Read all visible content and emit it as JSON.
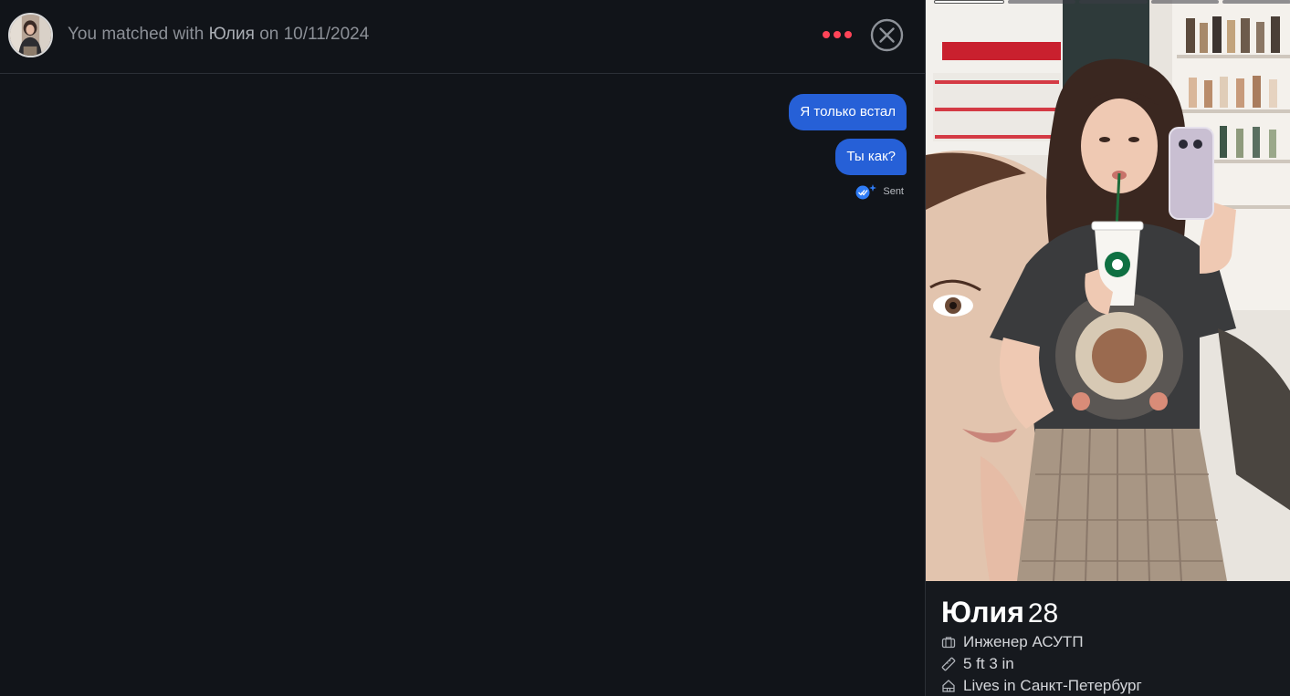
{
  "header": {
    "match_prefix": "You matched with",
    "match_name": "Юлия",
    "match_suffix": "on 10/11/2024",
    "accent_color": "#ff4458",
    "more_icon": "more-dots-icon",
    "close_icon": "close-circle-icon"
  },
  "messages": [
    {
      "text": "Я только встал"
    },
    {
      "text": "Ты как?"
    }
  ],
  "message_status": {
    "label": "Sent",
    "icon": "double-check-icon"
  },
  "bubble_color": "#2660d7",
  "profile": {
    "name": "Юлия",
    "age": "28",
    "photo_count": 5,
    "active_photo": 1,
    "details": [
      {
        "icon": "briefcase-icon",
        "text": "Инженер АСУТП"
      },
      {
        "icon": "ruler-icon",
        "text": "5 ft 3 in"
      },
      {
        "icon": "home-icon",
        "text": "Lives in Санкт-Петербург"
      }
    ]
  }
}
